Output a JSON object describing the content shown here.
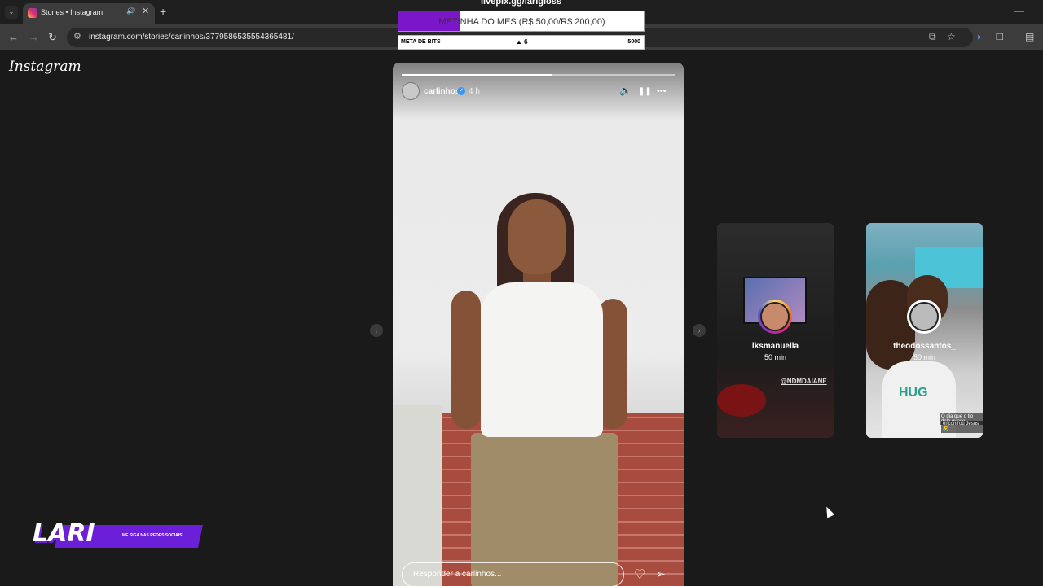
{
  "browser": {
    "tab_title": "Stories • Instagram",
    "tab_close": "✕",
    "tab_audio_icon": "🔊",
    "new_tab": "+",
    "tab_menu": "⌄",
    "window_minimize": "—",
    "url": "instagram.com/stories/carlinhos/3779586535554365481/",
    "back": "←",
    "forward": "→",
    "reload": "↻",
    "site_info": "⚙",
    "right_icons": [
      "⧉",
      "☆",
      "◗",
      "⧠",
      "▤"
    ]
  },
  "instagram": {
    "logo": "Instagram",
    "story": {
      "username": "carlinhos",
      "verified": "✓",
      "time": "4 h",
      "mute_icon": "🔈",
      "pause_icon": "❚❚",
      "more_icon": "•••",
      "reply_placeholder": "Responder a carlinhos...",
      "like_icon": "♡",
      "share_icon": "➢",
      "progress": 0.55
    },
    "prev_arrow": "‹",
    "next_arrow": "›",
    "other_stories": [
      {
        "username": "lksmanuella",
        "time": "50 min",
        "tag": "@NDMDAIANE"
      },
      {
        "username": "theodossantos_",
        "time": "50 min",
        "caption1": "O dia que o tio dele quase",
        "caption2": "encontrou Jesus 🤣",
        "logo": "HUG"
      }
    ]
  },
  "overlay": {
    "livepix": "livepix.gg/larigloss",
    "goal_text": "METINHA DO MES (R$ 50,00/R$ 200,00)",
    "goal_progress": 0.25,
    "bits_label": "META DE BITS",
    "bits_value": "6",
    "bits_goal": "5000",
    "brand_name": "LARI",
    "brand_sub": "ME SIGA NAS REDES SOCIAIS!"
  }
}
